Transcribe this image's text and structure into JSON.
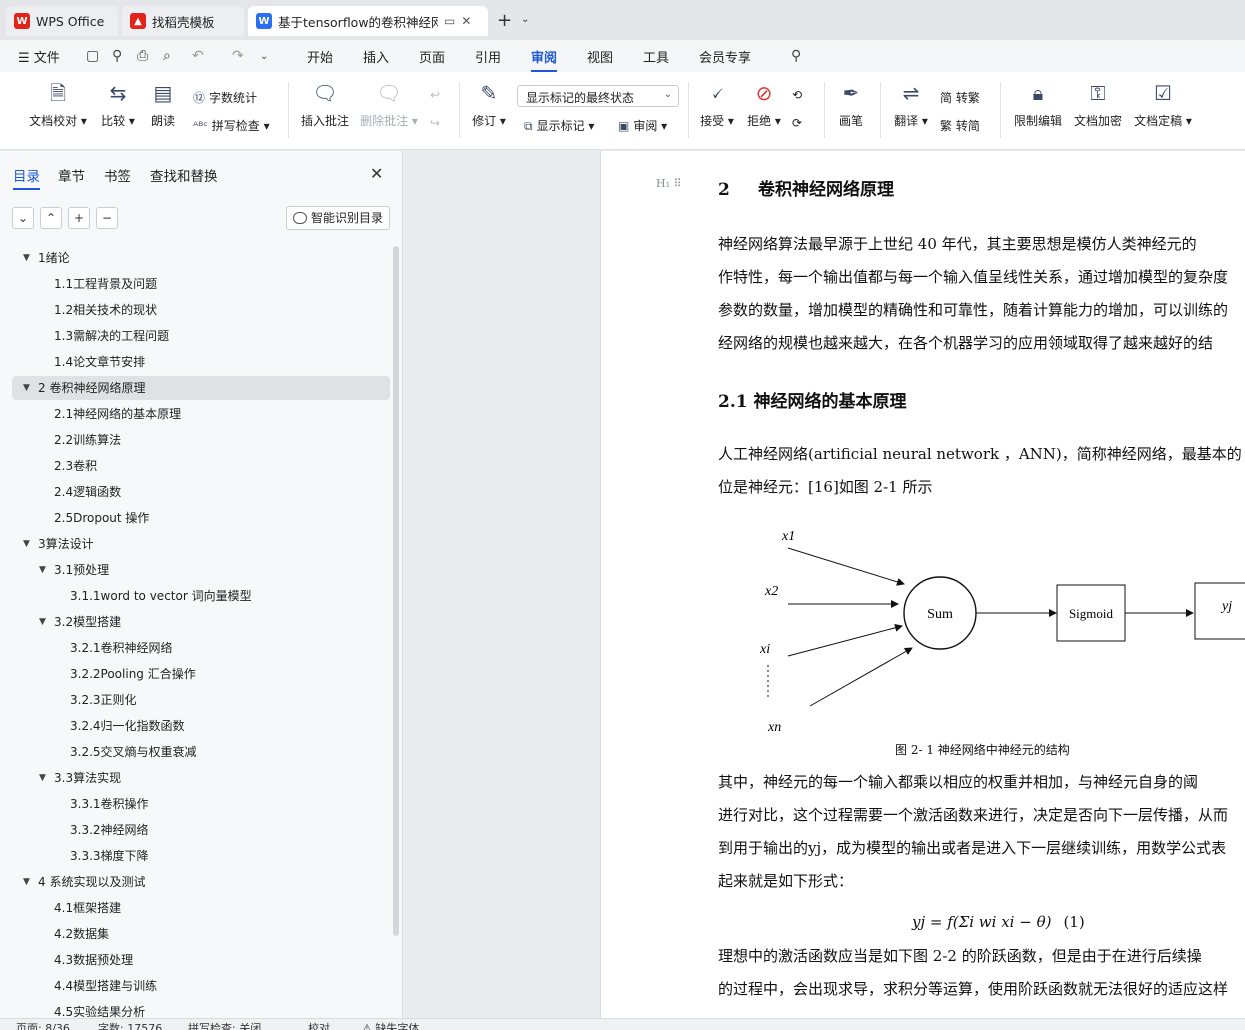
{
  "tabs": [
    {
      "label": "WPS Office",
      "icon": "wps-logo-icon"
    },
    {
      "label": "找稻壳模板",
      "icon": "docer-icon"
    },
    {
      "label": "基于tensorflow的卷积神经网络",
      "icon": "wps-writer-icon"
    }
  ],
  "menubar": {
    "file": "文件",
    "items": [
      "开始",
      "插入",
      "页面",
      "引用",
      "审阅",
      "视图",
      "工具",
      "会员专享"
    ],
    "active": "审阅"
  },
  "ribbon": {
    "doc_check": "文档校对",
    "compare": "比较",
    "read_aloud": "朗读",
    "word_count": "字数统计",
    "spell_check": "拼写检查",
    "insert_comment": "插入批注",
    "delete_comment": "删除批注",
    "revise": "修订",
    "markup_state": "显示标记的最终状态",
    "show_markup": "显示标记",
    "review_pane": "审阅",
    "accept": "接受",
    "reject": "拒绝",
    "pen": "画笔",
    "translate": "翻译",
    "trad": "简 转繁",
    "simp": "繁 转简",
    "restrict_edit": "限制编辑",
    "encrypt": "文档加密",
    "finalize": "文档定稿"
  },
  "sidebar": {
    "tabs": [
      "目录",
      "章节",
      "书签",
      "查找和替换"
    ],
    "active_tab": "目录",
    "smart_toc": "智能识别目录",
    "toc": [
      {
        "label": "1绪论",
        "level": 1,
        "expanded": true
      },
      {
        "label": "1.1工程背景及问题",
        "level": 2
      },
      {
        "label": "1.2相关技术的现状",
        "level": 2
      },
      {
        "label": "1.3需解决的工程问题",
        "level": 2
      },
      {
        "label": "1.4论文章节安排",
        "level": 2
      },
      {
        "label": "2  卷积神经网络原理",
        "level": 1,
        "expanded": true,
        "selected": true
      },
      {
        "label": "2.1神经网络的基本原理",
        "level": 2
      },
      {
        "label": "2.2训练算法",
        "level": 2
      },
      {
        "label": "2.3卷积",
        "level": 2
      },
      {
        "label": "2.4逻辑函数",
        "level": 2
      },
      {
        "label": "2.5Dropout 操作",
        "level": 2
      },
      {
        "label": "3算法设计",
        "level": 1,
        "expanded": true
      },
      {
        "label": "3.1预处理",
        "level": 2,
        "expanded": true
      },
      {
        "label": "3.1.1word to vector 词向量模型",
        "level": 3
      },
      {
        "label": "3.2模型搭建",
        "level": 2,
        "expanded": true
      },
      {
        "label": "3.2.1卷积神经网络",
        "level": 3
      },
      {
        "label": "3.2.2Pooling 汇合操作",
        "level": 3
      },
      {
        "label": "3.2.3正则化",
        "level": 3
      },
      {
        "label": "3.2.4归一化指数函数",
        "level": 3
      },
      {
        "label": "3.2.5交叉熵与权重衰减",
        "level": 3
      },
      {
        "label": "3.3算法实现",
        "level": 2,
        "expanded": true
      },
      {
        "label": "3.3.1卷积操作",
        "level": 3
      },
      {
        "label": "3.3.2神经网络",
        "level": 3
      },
      {
        "label": "3.3.3梯度下降",
        "level": 3
      },
      {
        "label": "4  系统实现以及测试",
        "level": 1,
        "expanded": true
      },
      {
        "label": "4.1框架搭建",
        "level": 2
      },
      {
        "label": "4.2数据集",
        "level": 2
      },
      {
        "label": "4.3数据预处理",
        "level": 2
      },
      {
        "label": "4.4模型搭建与训练",
        "level": 2
      },
      {
        "label": "4.5实验结果分析",
        "level": 2
      }
    ]
  },
  "document": {
    "h1_num": "2",
    "h1_text": "卷积神经网络原理",
    "p1": [
      "    神经网络算法最早源于上世纪 40 年代，其主要思想是模仿人类神经元的",
      "作特性，每一个输出值都与每一个输入值呈线性关系，通过增加模型的复杂度",
      "参数的数量，增加模型的精确性和可靠性，随着计算能力的增加，可以训练的",
      "经网络的规模也越来越大，在各个机器学习的应用领域取得了越来越好的结"
    ],
    "h2": "2.1 神经网络的基本原理",
    "p2": [
      "    人工神经网络(artificial neural network ，ANN)，简称神经网络，最基本的",
      "位是神经元：[16]如图 2-1 所示"
    ],
    "figure": {
      "inputs": [
        "x1",
        "x2",
        "xi",
        "xn"
      ],
      "sum": "Sum",
      "sigmoid": "Sigmoid",
      "output": "yj"
    },
    "caption": "图  2-  1  神经网络中神经元的结构",
    "p3": [
      "    其中，神经元的每一个输入都乘以相应的权重并相加，与神经元自身的阈",
      "进行对比，这个过程需要一个激活函数来进行，决定是否向下一层传播，从而",
      "到用于输出的yj，成为模型的输出或者是进入下一层继续训练，用数学公式表",
      "起来就是如下形式："
    ],
    "formula": "yj = f(Σi wi xi − θ)",
    "formula_no": "(1)",
    "p4": [
      "    理想中的激活函数应当是如下图 2-2 的阶跃函数，但是由于在进行后续操",
      "的过程中，会出现求导，求积分等运算，使用阶跃函数就无法很好的适应这样"
    ]
  },
  "status": {
    "page": "页面: 8/36",
    "words": "字数: 17576",
    "spell": "拼写检查: 关闭",
    "proof": "校对",
    "font": "缺失字体"
  }
}
